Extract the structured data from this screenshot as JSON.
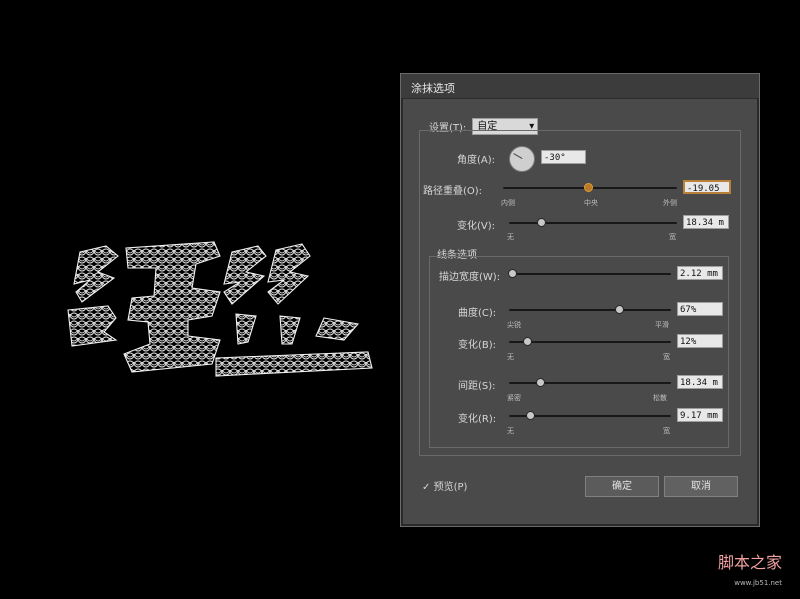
{
  "canvas": {
    "title_art": "缠丝"
  },
  "dialog": {
    "title": "涂抹选项",
    "settings_label": "设置(T):",
    "settings_value": "自定",
    "angle_label": "角度(A):",
    "angle_value": "-30°",
    "path_overlap_label": "路径重叠(O):",
    "path_overlap_value": "-19.05",
    "path_overlap_min": "内侧",
    "path_overlap_mid": "中央",
    "path_overlap_max": "外侧",
    "variation1_label": "变化(V):",
    "variation1_value": "18.34 m",
    "variation1_min": "无",
    "variation1_max": "宽",
    "line_options_label": "线条选项",
    "stroke_width_label": "描边宽度(W):",
    "stroke_width_value": "2.12 mm",
    "curviness_label": "曲度(C):",
    "curviness_value": "67%",
    "curviness_min": "尖锐",
    "curviness_max": "平滑",
    "variation2_label": "变化(B):",
    "variation2_value": "12%",
    "variation2_min": "无",
    "variation2_max": "宽",
    "spacing_label": "间距(S):",
    "spacing_value": "18.34 m",
    "spacing_min": "紧密",
    "spacing_max": "松散",
    "variation3_label": "变化(R):",
    "variation3_value": "9.17 mm",
    "variation3_min": "无",
    "variation3_max": "宽",
    "preview_label": "预览(P)",
    "ok_label": "确定",
    "cancel_label": "取消"
  },
  "watermark": {
    "line1": "脚本之家",
    "line2": "www.jb51.net"
  },
  "slider_levels": {
    "path_overlap": 0.49,
    "variation1": 0.19,
    "stroke_width": 0.02,
    "curviness": 0.68,
    "variation2": 0.11,
    "spacing": 0.19,
    "variation3": 0.13
  }
}
